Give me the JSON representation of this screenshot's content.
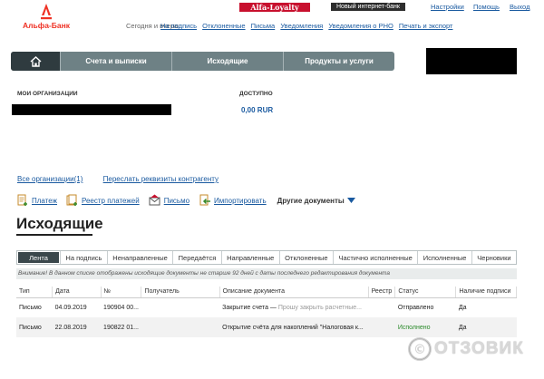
{
  "brand": {
    "name": "Альфа-Банк",
    "color": "#ef3124"
  },
  "header": {
    "loyalty_label": "Alfa-Loyalty",
    "new_bank_label": "Новый интернет-банк",
    "settings": "Настройки",
    "help": "Помощь",
    "logout": "Выход",
    "today_label": "Сегодня и вчера:",
    "quick_links": [
      "На подпись",
      "Отклоненные",
      "Письма",
      "Уведомления",
      "Уведомления о РНО",
      "Печать и экспорт"
    ]
  },
  "nav": {
    "home_icon": "home-icon",
    "tabs": [
      "Счета и выписки",
      "Исходящие",
      "Продукты и услуги"
    ]
  },
  "org": {
    "label": "МОИ ОРГАНИЗАЦИИ",
    "available_label": "ДОСТУПНО",
    "amount": "0,00 RUR",
    "all_orgs": "Все организации(1)",
    "resend": "Переслать реквизиты контрагенту"
  },
  "toolbar": {
    "items": [
      "Платеж",
      "Реестр платежей",
      "Письмо",
      "Импортировать"
    ],
    "other_docs": "Другие документы"
  },
  "page": {
    "title": "Исходящие",
    "notice": "Внимание! В данном списке отображены исходящие документы не старше 92 дней с даты последнего редактирования документа"
  },
  "filters": [
    "Лента",
    "На подпись",
    "Ненаправленные",
    "Передаётся",
    "Направленные",
    "Отклоненные",
    "Частично исполненные",
    "Исполненные",
    "Черновики"
  ],
  "table": {
    "headers": [
      "Тип",
      "Дата",
      "№",
      "Получатель",
      "Описание документа",
      "Реестр",
      "Статус",
      "Наличие подписи"
    ],
    "rows": [
      {
        "type": "Письмо",
        "date": "04.09.2019",
        "num": "190904 00...",
        "recipient": "",
        "description": "Закрытие счета —",
        "description_hint": "Прошу закрыть расчетные...",
        "registry": "",
        "status": "Отправлено",
        "signed": "Да"
      },
      {
        "type": "Письмо",
        "date": "22.08.2019",
        "num": "190822 01...",
        "recipient": "",
        "description": "Открытие счёта для накоплений \"Налоговая к...",
        "description_hint": "",
        "registry": "",
        "status": "Исполнено",
        "signed": "Да"
      }
    ]
  },
  "watermark": "ОТЗОВИК"
}
